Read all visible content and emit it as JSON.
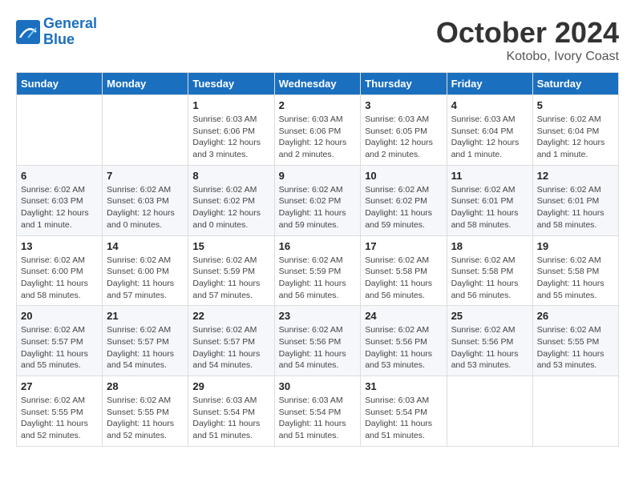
{
  "header": {
    "logo_line1": "General",
    "logo_line2": "Blue",
    "month_title": "October 2024",
    "subtitle": "Kotobo, Ivory Coast"
  },
  "days_of_week": [
    "Sunday",
    "Monday",
    "Tuesday",
    "Wednesday",
    "Thursday",
    "Friday",
    "Saturday"
  ],
  "weeks": [
    [
      {
        "day": "",
        "info": ""
      },
      {
        "day": "",
        "info": ""
      },
      {
        "day": "1",
        "info": "Sunrise: 6:03 AM\nSunset: 6:06 PM\nDaylight: 12 hours and 3 minutes."
      },
      {
        "day": "2",
        "info": "Sunrise: 6:03 AM\nSunset: 6:06 PM\nDaylight: 12 hours and 2 minutes."
      },
      {
        "day": "3",
        "info": "Sunrise: 6:03 AM\nSunset: 6:05 PM\nDaylight: 12 hours and 2 minutes."
      },
      {
        "day": "4",
        "info": "Sunrise: 6:03 AM\nSunset: 6:04 PM\nDaylight: 12 hours and 1 minute."
      },
      {
        "day": "5",
        "info": "Sunrise: 6:02 AM\nSunset: 6:04 PM\nDaylight: 12 hours and 1 minute."
      }
    ],
    [
      {
        "day": "6",
        "info": "Sunrise: 6:02 AM\nSunset: 6:03 PM\nDaylight: 12 hours and 1 minute."
      },
      {
        "day": "7",
        "info": "Sunrise: 6:02 AM\nSunset: 6:03 PM\nDaylight: 12 hours and 0 minutes."
      },
      {
        "day": "8",
        "info": "Sunrise: 6:02 AM\nSunset: 6:02 PM\nDaylight: 12 hours and 0 minutes."
      },
      {
        "day": "9",
        "info": "Sunrise: 6:02 AM\nSunset: 6:02 PM\nDaylight: 11 hours and 59 minutes."
      },
      {
        "day": "10",
        "info": "Sunrise: 6:02 AM\nSunset: 6:02 PM\nDaylight: 11 hours and 59 minutes."
      },
      {
        "day": "11",
        "info": "Sunrise: 6:02 AM\nSunset: 6:01 PM\nDaylight: 11 hours and 58 minutes."
      },
      {
        "day": "12",
        "info": "Sunrise: 6:02 AM\nSunset: 6:01 PM\nDaylight: 11 hours and 58 minutes."
      }
    ],
    [
      {
        "day": "13",
        "info": "Sunrise: 6:02 AM\nSunset: 6:00 PM\nDaylight: 11 hours and 58 minutes."
      },
      {
        "day": "14",
        "info": "Sunrise: 6:02 AM\nSunset: 6:00 PM\nDaylight: 11 hours and 57 minutes."
      },
      {
        "day": "15",
        "info": "Sunrise: 6:02 AM\nSunset: 5:59 PM\nDaylight: 11 hours and 57 minutes."
      },
      {
        "day": "16",
        "info": "Sunrise: 6:02 AM\nSunset: 5:59 PM\nDaylight: 11 hours and 56 minutes."
      },
      {
        "day": "17",
        "info": "Sunrise: 6:02 AM\nSunset: 5:58 PM\nDaylight: 11 hours and 56 minutes."
      },
      {
        "day": "18",
        "info": "Sunrise: 6:02 AM\nSunset: 5:58 PM\nDaylight: 11 hours and 56 minutes."
      },
      {
        "day": "19",
        "info": "Sunrise: 6:02 AM\nSunset: 5:58 PM\nDaylight: 11 hours and 55 minutes."
      }
    ],
    [
      {
        "day": "20",
        "info": "Sunrise: 6:02 AM\nSunset: 5:57 PM\nDaylight: 11 hours and 55 minutes."
      },
      {
        "day": "21",
        "info": "Sunrise: 6:02 AM\nSunset: 5:57 PM\nDaylight: 11 hours and 54 minutes."
      },
      {
        "day": "22",
        "info": "Sunrise: 6:02 AM\nSunset: 5:57 PM\nDaylight: 11 hours and 54 minutes."
      },
      {
        "day": "23",
        "info": "Sunrise: 6:02 AM\nSunset: 5:56 PM\nDaylight: 11 hours and 54 minutes."
      },
      {
        "day": "24",
        "info": "Sunrise: 6:02 AM\nSunset: 5:56 PM\nDaylight: 11 hours and 53 minutes."
      },
      {
        "day": "25",
        "info": "Sunrise: 6:02 AM\nSunset: 5:56 PM\nDaylight: 11 hours and 53 minutes."
      },
      {
        "day": "26",
        "info": "Sunrise: 6:02 AM\nSunset: 5:55 PM\nDaylight: 11 hours and 53 minutes."
      }
    ],
    [
      {
        "day": "27",
        "info": "Sunrise: 6:02 AM\nSunset: 5:55 PM\nDaylight: 11 hours and 52 minutes."
      },
      {
        "day": "28",
        "info": "Sunrise: 6:02 AM\nSunset: 5:55 PM\nDaylight: 11 hours and 52 minutes."
      },
      {
        "day": "29",
        "info": "Sunrise: 6:03 AM\nSunset: 5:54 PM\nDaylight: 11 hours and 51 minutes."
      },
      {
        "day": "30",
        "info": "Sunrise: 6:03 AM\nSunset: 5:54 PM\nDaylight: 11 hours and 51 minutes."
      },
      {
        "day": "31",
        "info": "Sunrise: 6:03 AM\nSunset: 5:54 PM\nDaylight: 11 hours and 51 minutes."
      },
      {
        "day": "",
        "info": ""
      },
      {
        "day": "",
        "info": ""
      }
    ]
  ]
}
